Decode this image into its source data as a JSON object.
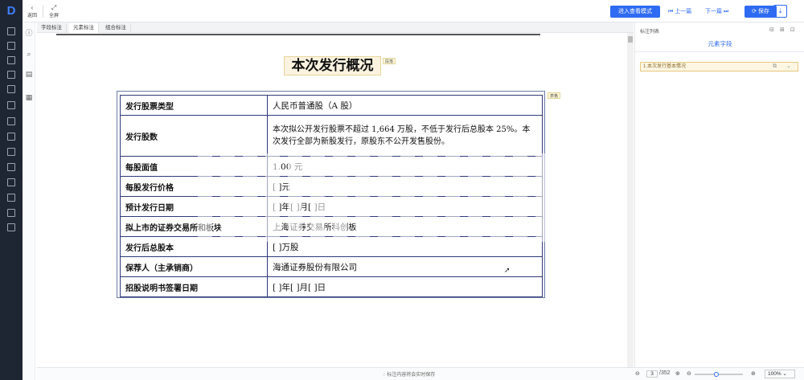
{
  "toolbar": {
    "back_label": "返回",
    "fullscreen_label": "全屏",
    "preview_mode_label": "进入查看模式",
    "prev_label": "上一篇",
    "next_label": "下一篇",
    "save_label": "保存"
  },
  "tabs": [
    {
      "label": "字段标注",
      "active": false
    },
    {
      "label": "元素标注",
      "active": true
    },
    {
      "label": "组合标注",
      "active": false
    }
  ],
  "document": {
    "title": "本次发行概况",
    "title_tag": "段落",
    "table_tag": "表格",
    "rows": [
      {
        "key": "发行股票类型",
        "value": "人民币普通股（A 股）"
      },
      {
        "key": "发行股数",
        "value": "本次拟公开发行股票不超过 1,664 万股，不低于发行后总股本 25%。本次发行全部为新股发行，原股东不公开发售股份。"
      },
      {
        "key": "每股面值",
        "value": "1.00 元"
      },
      {
        "key": "每股发行价格",
        "value": "[     ]元"
      },
      {
        "key": "预计发行日期",
        "value": "[     ]年[     ]月[     ]日"
      },
      {
        "key": "拟上市的证券交易所和板块",
        "value": "上海证券交易所科创板"
      },
      {
        "key": "发行后总股本",
        "value": "[     ]万股"
      },
      {
        "key": "保荐人（主承销商）",
        "value": "海通证券股份有限公司"
      },
      {
        "key": "招股说明书签署日期",
        "value": "[     ]年[     ]月[     ]日"
      }
    ]
  },
  "panel": {
    "header": "标注列表",
    "tab": "元素字段",
    "items": [
      {
        "label": "1.本次发行基本情况"
      }
    ]
  },
  "footer": {
    "hint": "标注内容将会实时保存",
    "page_current": "3",
    "page_total": "/352",
    "zoom": "100%"
  },
  "colors": {
    "accent": "#2f6bf2",
    "rail": "#1f2633",
    "highlight": "#fbf3df"
  }
}
